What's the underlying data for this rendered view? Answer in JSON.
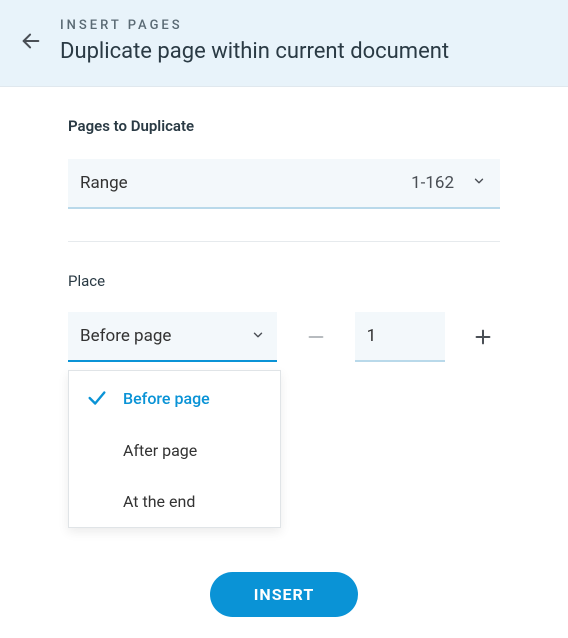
{
  "header": {
    "breadcrumb": "INSERT PAGES",
    "title": "Duplicate page within current document"
  },
  "pages_section": {
    "label": "Pages to Duplicate",
    "mode_label": "Range",
    "range_value": "1-162"
  },
  "place_section": {
    "label": "Place",
    "selected_label": "Before page",
    "page_number": "1",
    "options": [
      {
        "label": "Before page",
        "selected": true
      },
      {
        "label": "After page",
        "selected": false
      },
      {
        "label": "At the end",
        "selected": false
      }
    ]
  },
  "actions": {
    "insert_label": "INSERT"
  }
}
